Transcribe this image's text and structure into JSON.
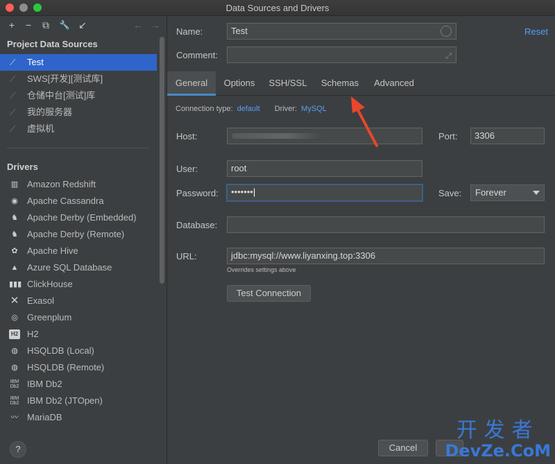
{
  "window": {
    "title": "Data Sources and Drivers"
  },
  "toolbar": {
    "add": "+",
    "remove": "−",
    "copy": "⧉",
    "wrench": "🔧",
    "import": "↙",
    "back": "←",
    "forward": "→"
  },
  "sidebar": {
    "project_title": "Project Data Sources",
    "data_sources": [
      {
        "label": "Test",
        "selected": true
      },
      {
        "label": "SWS[开发][测试库]"
      },
      {
        "label": "仓储中台[测试]库"
      },
      {
        "label": "我的服务器"
      },
      {
        "label": "虚拟机"
      }
    ],
    "drivers_title": "Drivers",
    "drivers": [
      {
        "label": "Amazon Redshift",
        "icon": "redshift-icon"
      },
      {
        "label": "Apache Cassandra",
        "icon": "cassandra-icon"
      },
      {
        "label": "Apache Derby (Embedded)",
        "icon": "derby-icon"
      },
      {
        "label": "Apache Derby (Remote)",
        "icon": "derby-icon"
      },
      {
        "label": "Apache Hive",
        "icon": "hive-icon"
      },
      {
        "label": "Azure SQL Database",
        "icon": "azure-icon"
      },
      {
        "label": "ClickHouse",
        "icon": "clickhouse-icon"
      },
      {
        "label": "Exasol",
        "icon": "exasol-icon"
      },
      {
        "label": "Greenplum",
        "icon": "greenplum-icon"
      },
      {
        "label": "H2",
        "icon": "h2-icon"
      },
      {
        "label": "HSQLDB (Local)",
        "icon": "hsqldb-icon"
      },
      {
        "label": "HSQLDB (Remote)",
        "icon": "hsqldb-icon"
      },
      {
        "label": "IBM Db2",
        "icon": "db2-icon"
      },
      {
        "label": "IBM Db2 (JTOpen)",
        "icon": "db2-icon"
      },
      {
        "label": "MariaDB",
        "icon": "mariadb-icon"
      }
    ],
    "help": "?"
  },
  "form": {
    "name_label": "Name:",
    "name_value": "Test",
    "comment_label": "Comment:",
    "comment_value": "",
    "reset": "Reset",
    "tabs": [
      "General",
      "Options",
      "SSH/SSL",
      "Schemas",
      "Advanced"
    ],
    "active_tab": "General",
    "connection_type_label": "Connection type:",
    "connection_type_value": "default",
    "driver_label": "Driver:",
    "driver_value": "MySQL",
    "host_label": "Host:",
    "port_label": "Port:",
    "port_value": "3306",
    "user_label": "User:",
    "user_value": "root",
    "password_label": "Password:",
    "password_value": "•••••••",
    "save_label": "Save:",
    "save_value": "Forever",
    "database_label": "Database:",
    "database_value": "",
    "url_label": "URL:",
    "url_value": "jdbc:mysql://www.liyanxing.top:3306",
    "url_hint": "Overrides settings above",
    "test_connection": "Test Connection"
  },
  "footer": {
    "cancel": "Cancel"
  },
  "watermark": {
    "cn": "开发者",
    "en": "DevZe.CoM"
  },
  "colors": {
    "selection": "#2f65ca",
    "link": "#589df6",
    "annotation_arrow": "#e8472c"
  }
}
